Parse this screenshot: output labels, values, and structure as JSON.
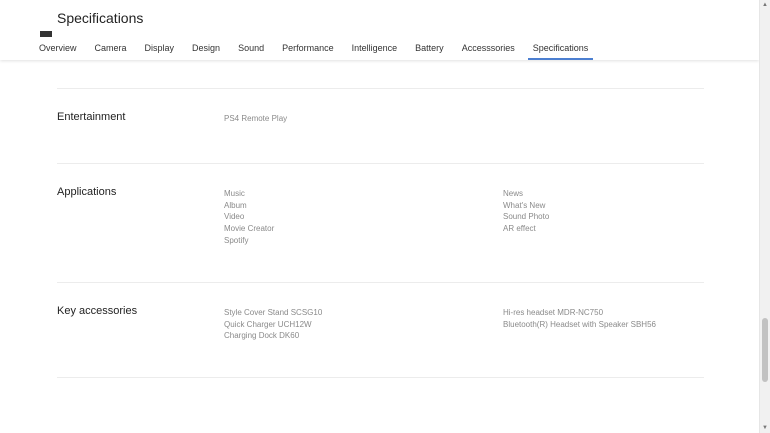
{
  "header": {
    "title": "Specifications",
    "tabs": [
      {
        "label": "Overview",
        "active": false
      },
      {
        "label": "Camera",
        "active": false
      },
      {
        "label": "Display",
        "active": false
      },
      {
        "label": "Design",
        "active": false
      },
      {
        "label": "Sound",
        "active": false
      },
      {
        "label": "Performance",
        "active": false
      },
      {
        "label": "Intelligence",
        "active": false
      },
      {
        "label": "Battery",
        "active": false
      },
      {
        "label": "Accesssories",
        "active": false
      },
      {
        "label": "Specifications",
        "active": true
      }
    ],
    "accent_color": "#4c7fd1"
  },
  "sections": {
    "entertainment": {
      "title": "Entertainment",
      "col1": [
        "PS4 Remote Play"
      ]
    },
    "applications": {
      "title": "Applications",
      "col1": [
        "Music",
        "Album",
        "Video",
        "Movie Creator",
        "Spotify"
      ],
      "col2": [
        "News",
        "What's New",
        "Sound Photo",
        "AR effect"
      ]
    },
    "key_accessories": {
      "title": "Key accessories",
      "col1": [
        "Style Cover Stand SCSG10",
        "Quick Charger UCH12W",
        "Charging Dock DK60"
      ],
      "col2": [
        "Hi-res headset MDR-NC750",
        "Bluetooth(R) Headset with Speaker SBH56"
      ]
    }
  },
  "scrollbar": {
    "up_icon": "triangle-up",
    "down_icon": "triangle-down",
    "position_fraction": 0.78
  }
}
